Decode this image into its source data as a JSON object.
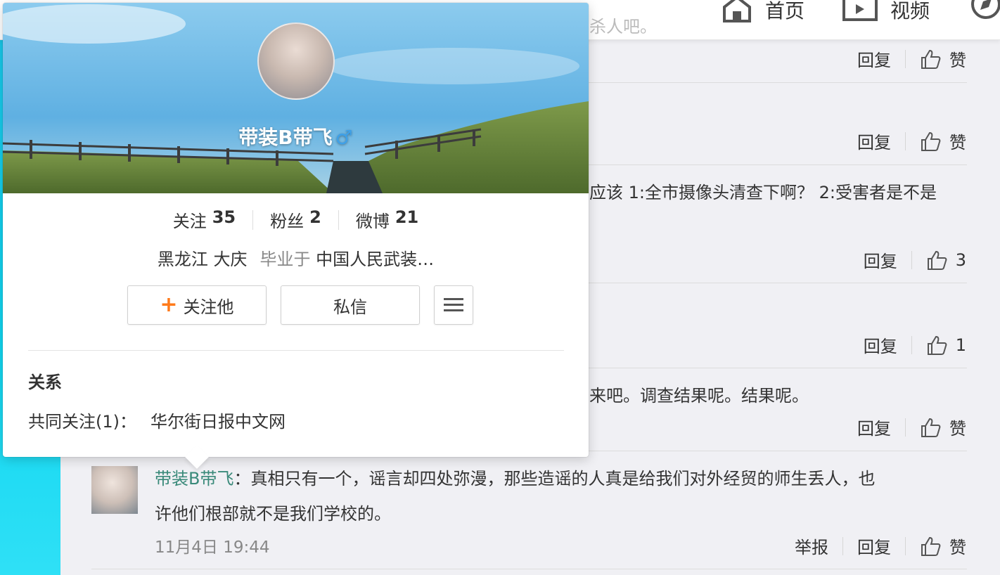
{
  "nav": {
    "home_label": "首页",
    "video_label": "视频",
    "faded_text": "杀人吧。"
  },
  "card": {
    "name": "带装B带飞",
    "gender_symbol": "♂",
    "stats": [
      {
        "label": "关注",
        "value": "35"
      },
      {
        "label": "粉丝",
        "value": "2"
      },
      {
        "label": "微博",
        "value": "21"
      }
    ],
    "location": "黑龙江 大庆",
    "edu_prefix": "毕业于",
    "school": "中国人民武装…",
    "follow_label": "关注他",
    "message_label": "私信",
    "relation_title": "关系",
    "mutual_label": "共同关注(1)：",
    "mutual_name": "华尔街日报中文网"
  },
  "feed": {
    "comments": [
      {
        "reply": "回复",
        "like": "赞"
      },
      {
        "reply": "回复",
        "like": "赞"
      },
      {
        "text": "应该 1:全市摄像头清查下啊？ 2:受害者是不是",
        "reply": "回复",
        "like": "3"
      },
      {
        "reply": "回复",
        "like": "1"
      },
      {
        "text": "来吧。调查结果呢。结果呢。",
        "reply": "回复",
        "like": "赞"
      }
    ],
    "last": {
      "username": "带装B带飞",
      "colon": "：",
      "text_line1": "真相只有一个，谣言却四处弥漫，那些造谣的人真是给我们对外经贸的师生丢人，也",
      "text_line2": "许他们根部就不是我们学校的。",
      "time": "11月4日 19:44",
      "report": "举报",
      "reply": "回复",
      "like": "赞"
    }
  }
}
